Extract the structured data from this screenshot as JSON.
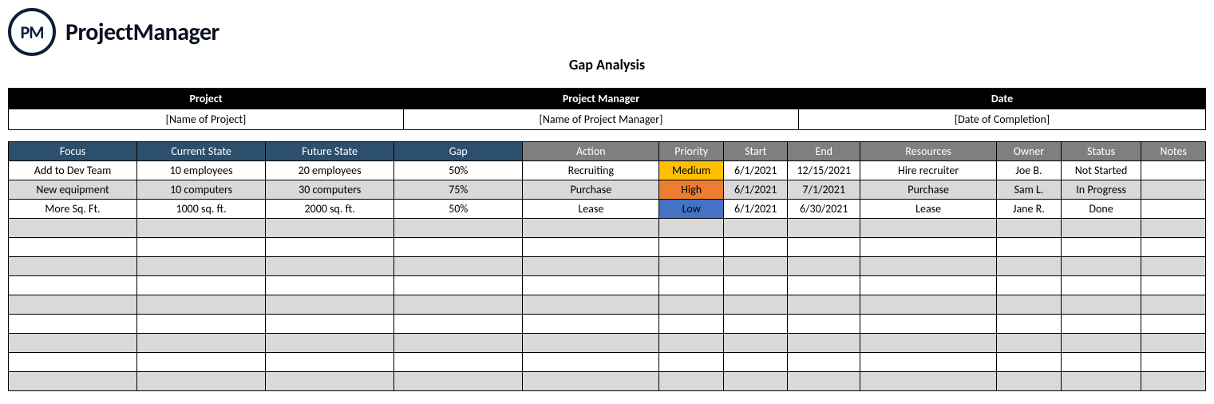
{
  "brand": {
    "logo_abbr": "PM",
    "name": "ProjectManager"
  },
  "title": "Gap Analysis",
  "meta": {
    "headers": [
      "Project",
      "Project Manager",
      "Date"
    ],
    "values": [
      "[Name of Project]",
      "[Name of Project Manager]",
      "[Date of Completion]"
    ]
  },
  "columns": [
    "Focus",
    "Current State",
    "Future State",
    "Gap",
    "Action",
    "Priority",
    "Start",
    "End",
    "Resources",
    "Owner",
    "Status",
    "Notes"
  ],
  "rows": [
    {
      "focus": "Add to Dev Team",
      "current": "10 employees",
      "future": "20 employees",
      "gap": "50%",
      "action": "Recruiting",
      "priority": "Medium",
      "start": "6/1/2021",
      "end": "12/15/2021",
      "resources": "Hire recruiter",
      "owner": "Joe B.",
      "status": "Not Started",
      "notes": ""
    },
    {
      "focus": "New equipment",
      "current": "10 computers",
      "future": "30 computers",
      "gap": "75%",
      "action": "Purchase",
      "priority": "High",
      "start": "6/1/2021",
      "end": "7/1/2021",
      "resources": "Purchase",
      "owner": "Sam L.",
      "status": "In Progress",
      "notes": ""
    },
    {
      "focus": "More Sq. Ft.",
      "current": "1000 sq. ft.",
      "future": "2000 sq. ft.",
      "gap": "50%",
      "action": "Lease",
      "priority": "Low",
      "start": "6/1/2021",
      "end": "6/30/2021",
      "resources": "Lease",
      "owner": "Jane R.",
      "status": "Done",
      "notes": ""
    }
  ],
  "empty_rows": 9,
  "priority_colors": {
    "Medium": "#ffc000",
    "High": "#ed7d31",
    "Low": "#4472c4"
  }
}
